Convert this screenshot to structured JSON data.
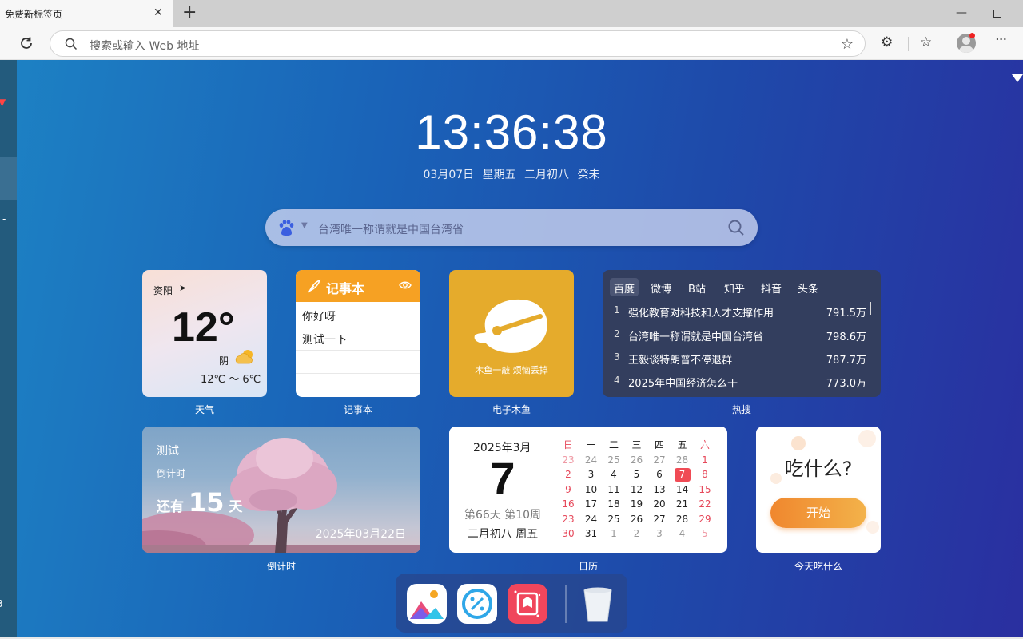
{
  "browser": {
    "tab_title": "免费新标签页",
    "tab_close": "✕",
    "new_tab": "+",
    "minimize": "—",
    "address_placeholder": "搜索或输入 Web 地址",
    "more": "···"
  },
  "clock": {
    "time": "13:36:38",
    "date": "03月07日",
    "weekday": "星期五",
    "lunar": "二月初八",
    "ganzhi": "癸未"
  },
  "search": {
    "engine_icon": "baidu-paw-icon",
    "placeholder": "台湾唯一称谓就是中国台湾省"
  },
  "weather": {
    "city": "资阳",
    "temperature": "12°",
    "condition": "阴",
    "range": "12℃ ～ 6℃",
    "label": "天气"
  },
  "notepad": {
    "title": "记事本",
    "lines": [
      "你好呀",
      "测试一下",
      ""
    ],
    "label": "记事本"
  },
  "muyu": {
    "caption": "木鱼一敲 烦恼丢掉",
    "label": "电子木鱼"
  },
  "hot": {
    "tabs": [
      "百度",
      "微博",
      "B站",
      "知乎",
      "抖音",
      "头条"
    ],
    "active_tab": "百度",
    "items": [
      {
        "rank": "1",
        "title": "强化教育对科技和人才支撑作用",
        "count": "791.5万"
      },
      {
        "rank": "2",
        "title": "台湾唯一称谓就是中国台湾省",
        "count": "798.6万"
      },
      {
        "rank": "3",
        "title": "王毅谈特朗普不停退群",
        "count": "787.7万"
      },
      {
        "rank": "4",
        "title": "2025年中国经济怎么干",
        "count": "773.0万"
      }
    ],
    "label": "热搜"
  },
  "countdown": {
    "title": "测试",
    "subtitle": "倒计时",
    "prefix": "还有",
    "days": "15",
    "suffix": "天",
    "target_date": "2025年03月22日",
    "label": "倒计时"
  },
  "calendar": {
    "month": "2025年3月",
    "day": "7",
    "week_info": "第66天 第10周",
    "lunar": "二月初八 周五",
    "headers": [
      "日",
      "一",
      "二",
      "三",
      "四",
      "五",
      "六"
    ],
    "weeks": [
      [
        "23",
        "24",
        "25",
        "26",
        "27",
        "28",
        "1"
      ],
      [
        "2",
        "3",
        "4",
        "5",
        "6",
        "7",
        "8"
      ],
      [
        "9",
        "10",
        "11",
        "12",
        "13",
        "14",
        "15"
      ],
      [
        "16",
        "17",
        "18",
        "19",
        "20",
        "21",
        "22"
      ],
      [
        "23",
        "24",
        "25",
        "26",
        "27",
        "28",
        "29"
      ],
      [
        "30",
        "31",
        "1",
        "2",
        "3",
        "4",
        "5"
      ]
    ],
    "label": "日历"
  },
  "eat": {
    "title": "吃什么?",
    "button": "开始",
    "label": "今天吃什么"
  },
  "dock": {
    "apps": [
      "gallery-app-icon",
      "discount-app-icon",
      "wallpaper-app-icon",
      "trash-icon"
    ]
  },
  "colors": {
    "accent_orange": "#f6a123",
    "today_red": "#f04b55",
    "page_blue": "#1a63b8"
  }
}
